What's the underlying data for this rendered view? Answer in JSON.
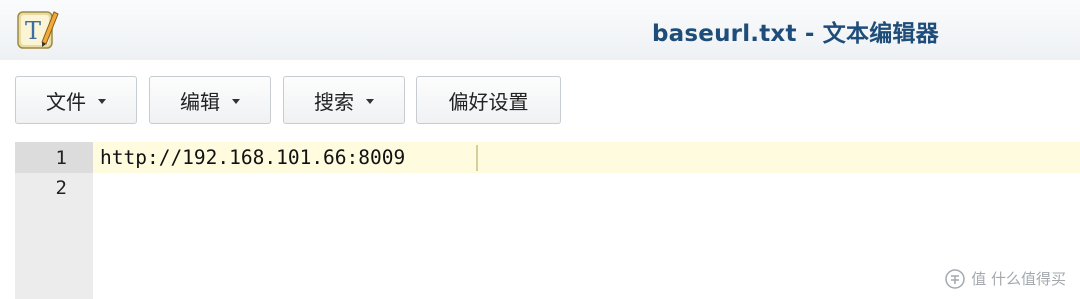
{
  "window": {
    "title": "baseurl.txt - 文本编辑器",
    "app_icon": "text-editor-icon"
  },
  "toolbar": {
    "file_label": "文件",
    "edit_label": "编辑",
    "search_label": "搜索",
    "prefs_label": "偏好设置"
  },
  "editor": {
    "line_numbers": [
      "1",
      "2"
    ],
    "lines": [
      "http://192.168.101.66:8009",
      ""
    ]
  },
  "watermark": {
    "text": "值 什么值得买",
    "icon": "smzdm-logo-icon"
  },
  "colors": {
    "title": "#1f4d7a",
    "active_line": "#fffbdf",
    "gutter": "#ececec"
  }
}
